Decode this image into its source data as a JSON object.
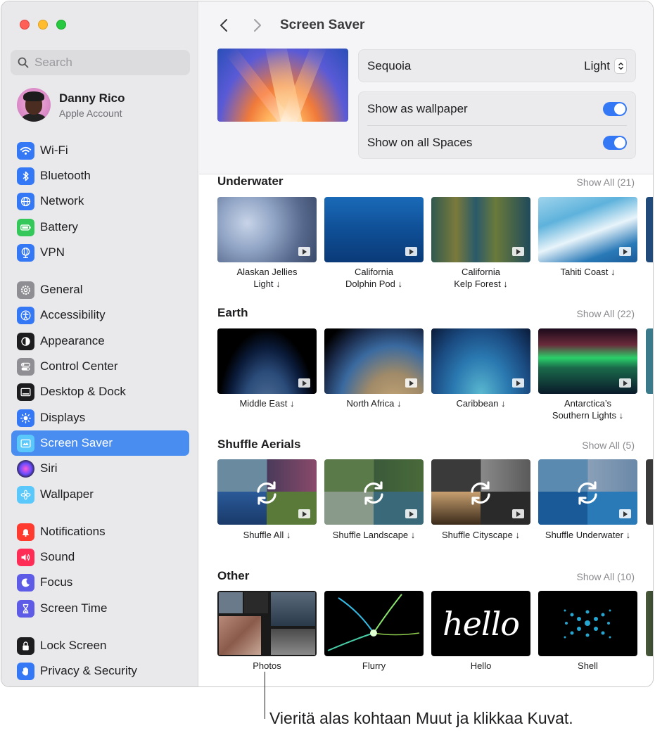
{
  "sidebar": {
    "search": {
      "placeholder": "Search"
    },
    "account": {
      "name": "Danny Rico",
      "subtitle": "Apple Account"
    },
    "items": [
      {
        "label": "Wi-Fi",
        "icon": "wifi-icon",
        "color": "#3478f6"
      },
      {
        "label": "Bluetooth",
        "icon": "bluetooth-icon",
        "color": "#3478f6"
      },
      {
        "label": "Network",
        "icon": "globe-icon",
        "color": "#3478f6"
      },
      {
        "label": "Battery",
        "icon": "battery-icon",
        "color": "#34c759"
      },
      {
        "label": "VPN",
        "icon": "vpn-icon",
        "color": "#3478f6"
      },
      {
        "label": "General",
        "icon": "gear-icon",
        "color": "#8e8e93"
      },
      {
        "label": "Accessibility",
        "icon": "accessibility-icon",
        "color": "#3478f6"
      },
      {
        "label": "Appearance",
        "icon": "appearance-icon",
        "color": "#1d1d1f"
      },
      {
        "label": "Control Center",
        "icon": "control-center-icon",
        "color": "#8e8e93"
      },
      {
        "label": "Desktop & Dock",
        "icon": "dock-icon",
        "color": "#1d1d1f"
      },
      {
        "label": "Displays",
        "icon": "sun-icon",
        "color": "#3478f6"
      },
      {
        "label": "Screen Saver",
        "icon": "screen-saver-icon",
        "color": "#5ac8fa"
      },
      {
        "label": "Siri",
        "icon": "siri-icon",
        "color": "#2c2c2e"
      },
      {
        "label": "Wallpaper",
        "icon": "wallpaper-icon",
        "color": "#5ac8fa"
      },
      {
        "label": "Notifications",
        "icon": "bell-icon",
        "color": "#ff3b30"
      },
      {
        "label": "Sound",
        "icon": "speaker-icon",
        "color": "#ff2d55"
      },
      {
        "label": "Focus",
        "icon": "moon-icon",
        "color": "#5e5ce6"
      },
      {
        "label": "Screen Time",
        "icon": "hourglass-icon",
        "color": "#5e5ce6"
      },
      {
        "label": "Lock Screen",
        "icon": "lock-icon",
        "color": "#1d1d1f"
      },
      {
        "label": "Privacy & Security",
        "icon": "hand-icon",
        "color": "#3478f6"
      }
    ],
    "selected": "Screen Saver"
  },
  "main": {
    "title": "Screen Saver",
    "current": {
      "name": "Sequoia",
      "variant": "Light"
    },
    "toggles": [
      {
        "label": "Show as wallpaper",
        "on": true
      },
      {
        "label": "Show on all Spaces",
        "on": true
      }
    ],
    "sections": [
      {
        "title": "Underwater",
        "show_all": "Show All (21)",
        "items": [
          {
            "line1": "Alaskan Jellies",
            "line2": "Light ↓"
          },
          {
            "line1": "California",
            "line2": "Dolphin Pod ↓"
          },
          {
            "line1": "California",
            "line2": "Kelp Forest ↓"
          },
          {
            "line1": "Tahiti Coast ↓",
            "line2": ""
          }
        ]
      },
      {
        "title": "Earth",
        "show_all": "Show All (22)",
        "items": [
          {
            "line1": "Middle East ↓",
            "line2": ""
          },
          {
            "line1": "North Africa ↓",
            "line2": ""
          },
          {
            "line1": "Caribbean ↓",
            "line2": ""
          },
          {
            "line1": "Antarctica’s",
            "line2": "Southern Lights ↓"
          }
        ]
      },
      {
        "title": "Shuffle Aerials",
        "show_all": "Show All (5)",
        "items": [
          {
            "line1": "Shuffle All ↓",
            "line2": ""
          },
          {
            "line1": "Shuffle Landscape ↓",
            "line2": ""
          },
          {
            "line1": "Shuffle Cityscape ↓",
            "line2": ""
          },
          {
            "line1": "Shuffle Underwater ↓",
            "line2": ""
          }
        ]
      },
      {
        "title": "Other",
        "show_all": "Show All (10)",
        "items": [
          {
            "line1": "Photos",
            "line2": ""
          },
          {
            "line1": "Flurry",
            "line2": ""
          },
          {
            "line1": "Hello",
            "line2": ""
          },
          {
            "line1": "Shell",
            "line2": ""
          }
        ]
      }
    ],
    "hello_art_text": "hello"
  },
  "callout": {
    "text": "Vieritä alas kohtaan Muut ja klikkaa Kuvat."
  },
  "colors": {
    "accent": "#3478f6",
    "selection": "#4a8df0"
  }
}
